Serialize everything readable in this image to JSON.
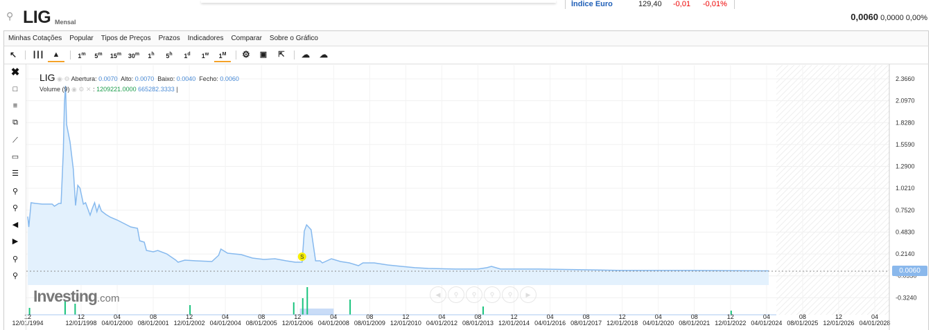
{
  "top_strip": {
    "name": "Índice Euro",
    "value": "129,40",
    "change": "-0,01",
    "change_pct": "-0,01%"
  },
  "header": {
    "symbol": "LIG",
    "period": "Mensal",
    "price": "0,0060",
    "change": "0,0000",
    "change_pct": "0,00%"
  },
  "menu": [
    "Minhas Cotações",
    "Popular",
    "Tipos de Preços",
    "Prazos",
    "Indicadores",
    "Comparar",
    "Sobre o Gráfico"
  ],
  "timeframes": [
    {
      "n": "1",
      "s": "m"
    },
    {
      "n": "5",
      "s": "m"
    },
    {
      "n": "15",
      "s": "m"
    },
    {
      "n": "30",
      "s": "m"
    },
    {
      "n": "1",
      "s": "h"
    },
    {
      "n": "5",
      "s": "h"
    },
    {
      "n": "1",
      "s": "d"
    },
    {
      "n": "1",
      "s": "w"
    },
    {
      "n": "1",
      "s": "M"
    }
  ],
  "active_timeframe": "1M",
  "active_chart_type": "area",
  "legend": {
    "symbol": "LIG",
    "open_label": "Abertura:",
    "open": "0.0070",
    "high_label": "Alto:",
    "high": "0.0070",
    "low_label": "Baixo:",
    "low": "0.0040",
    "close_label": "Fecho:",
    "close": "0.0060",
    "volume_label": "Volume (9)",
    "volume_value1": "1209221.0000",
    "volume_value2": "665282.3333"
  },
  "watermark": {
    "brand": "Investing",
    "suffix": ".com"
  },
  "event_marker": "S",
  "colors": {
    "line": "#86b9ee",
    "fill": "#e3f1fd",
    "volume_up": "#19c37d",
    "price_box": "#8ab8ec",
    "active_underline": "#f4a228"
  },
  "chart_data": {
    "type": "area",
    "current_price": "0.0060",
    "y_ticks": [
      "2.3660",
      "2.0970",
      "1.8280",
      "1.5590",
      "1.2900",
      "1.0210",
      "0.7520",
      "0.4830",
      "0.2140",
      "-0.0550",
      "-0.3240"
    ],
    "x_ticks": [
      {
        "top": "12",
        "bottom": "12/01/1994",
        "date": "1994-12"
      },
      {
        "top": "12",
        "bottom": "12/01/1998",
        "date": "1998-12"
      },
      {
        "top": "04",
        "bottom": "04/01/2000",
        "date": "2000-04"
      },
      {
        "top": "08",
        "bottom": "08/01/2001",
        "date": "2001-08"
      },
      {
        "top": "12",
        "bottom": "12/01/2002",
        "date": "2002-12"
      },
      {
        "top": "04",
        "bottom": "04/01/2004",
        "date": "2004-04"
      },
      {
        "top": "08",
        "bottom": "08/01/2005",
        "date": "2005-08"
      },
      {
        "top": "12",
        "bottom": "12/01/2006",
        "date": "2006-12"
      },
      {
        "top": "04",
        "bottom": "04/01/2008",
        "date": "2008-04"
      },
      {
        "top": "08",
        "bottom": "08/01/2009",
        "date": "2009-08"
      },
      {
        "top": "12",
        "bottom": "12/01/2010",
        "date": "2010-12"
      },
      {
        "top": "04",
        "bottom": "04/01/2012",
        "date": "2012-04"
      },
      {
        "top": "08",
        "bottom": "08/01/2013",
        "date": "2013-08"
      },
      {
        "top": "12",
        "bottom": "12/01/2014",
        "date": "2014-12"
      },
      {
        "top": "04",
        "bottom": "04/01/2016",
        "date": "2016-04"
      },
      {
        "top": "08",
        "bottom": "08/01/2017",
        "date": "2017-08"
      },
      {
        "top": "12",
        "bottom": "12/01/2018",
        "date": "2018-12"
      },
      {
        "top": "04",
        "bottom": "04/01/2020",
        "date": "2020-04"
      },
      {
        "top": "08",
        "bottom": "08/01/2021",
        "date": "2021-08"
      },
      {
        "top": "12",
        "bottom": "12/01/2022",
        "date": "2022-12"
      },
      {
        "top": "04",
        "bottom": "04/01/2024",
        "date": "2024-04"
      },
      {
        "top": "08",
        "bottom": "08/01/2025",
        "date": "2025-08"
      },
      {
        "top": "12",
        "bottom": "12/01/2026",
        "date": "2026-12"
      },
      {
        "top": "04",
        "bottom": "04/01/2028",
        "date": "2028-04"
      }
    ],
    "series": [
      [
        "1994-12",
        0.674
      ],
      [
        "1995-01",
        0.546
      ],
      [
        "1995-03",
        0.844
      ],
      [
        "1995-07",
        0.835
      ],
      [
        "1996-01",
        0.827
      ],
      [
        "1996-10",
        0.827
      ],
      [
        "1996-12",
        0.801
      ],
      [
        "1997-04",
        0.835
      ],
      [
        "1997-06",
        0.835
      ],
      [
        "1997-08",
        1.465
      ],
      [
        "1997-09",
        2.06
      ],
      [
        "1997-10",
        2.281
      ],
      [
        "1997-11",
        1.805
      ],
      [
        "1998-02",
        1.592
      ],
      [
        "1998-05",
        1.252
      ],
      [
        "1998-07",
        0.81
      ],
      [
        "1998-09",
        1.057
      ],
      [
        "1998-11",
        1.023
      ],
      [
        "1999-01",
        0.827
      ],
      [
        "1999-02",
        0.844
      ],
      [
        "1999-04",
        0.691
      ],
      [
        "1999-05",
        0.776
      ],
      [
        "1999-06",
        0.844
      ],
      [
        "1999-07",
        0.733
      ],
      [
        "1999-08",
        0.818
      ],
      [
        "1999-09",
        0.742
      ],
      [
        "1999-11",
        0.699
      ],
      [
        "2000-01",
        0.665
      ],
      [
        "2000-04",
        0.631
      ],
      [
        "2000-07",
        0.589
      ],
      [
        "2000-10",
        0.546
      ],
      [
        "2001-01",
        0.529
      ],
      [
        "2001-02",
        0.376
      ],
      [
        "2001-04",
        0.359
      ],
      [
        "2001-05",
        0.257
      ],
      [
        "2001-08",
        0.24
      ],
      [
        "2001-10",
        0.257
      ],
      [
        "2002-02",
        0.215
      ],
      [
        "2002-06",
        0.138
      ],
      [
        "2002-07",
        0.113
      ],
      [
        "2002-10",
        0.138
      ],
      [
        "2003-03",
        0.13
      ],
      [
        "2003-10",
        0.121
      ],
      [
        "2004-01",
        0.198
      ],
      [
        "2004-02",
        0.274
      ],
      [
        "2004-05",
        0.223
      ],
      [
        "2004-11",
        0.206
      ],
      [
        "2005-04",
        0.164
      ],
      [
        "2005-09",
        0.147
      ],
      [
        "2006-02",
        0.155
      ],
      [
        "2006-07",
        0.13
      ],
      [
        "2006-11",
        0.113
      ],
      [
        "2007-02",
        0.113
      ],
      [
        "2007-03",
        0.495
      ],
      [
        "2007-04",
        0.572
      ],
      [
        "2007-06",
        0.512
      ],
      [
        "2007-08",
        0.13
      ],
      [
        "2007-10",
        0.13
      ],
      [
        "2007-11",
        0.104
      ],
      [
        "2008-03",
        0.155
      ],
      [
        "2008-07",
        0.121
      ],
      [
        "2008-11",
        0.104
      ],
      [
        "2009-03",
        0.07
      ],
      [
        "2009-05",
        0.104
      ],
      [
        "2009-10",
        0.104
      ],
      [
        "2010-04",
        0.079
      ],
      [
        "2010-10",
        0.062
      ],
      [
        "2011-04",
        0.045
      ],
      [
        "2011-10",
        0.036
      ],
      [
        "2012-10",
        0.028
      ],
      [
        "2013-08",
        0.028
      ],
      [
        "2013-12",
        0.045
      ],
      [
        "2014-02",
        0.062
      ],
      [
        "2014-06",
        0.028
      ],
      [
        "2015-11",
        0.028
      ],
      [
        "2017-09",
        0.019
      ],
      [
        "2018-12",
        0.011
      ],
      [
        "2021-07",
        0.011
      ],
      [
        "2024-05",
        0.006
      ]
    ],
    "volume_relative": [
      [
        "1995-01",
        0.25
      ],
      [
        "1997-09",
        0.5
      ],
      [
        "1998-06",
        0.4
      ],
      [
        "2002-12",
        0.35
      ],
      [
        "2006-10",
        0.45
      ],
      [
        "2007-02",
        0.6
      ],
      [
        "2007-04",
        1.0
      ],
      [
        "2008-11",
        0.55
      ],
      [
        "2013-10",
        0.3
      ],
      [
        "2022-12",
        0.15
      ]
    ],
    "event_date": "2007-02"
  }
}
